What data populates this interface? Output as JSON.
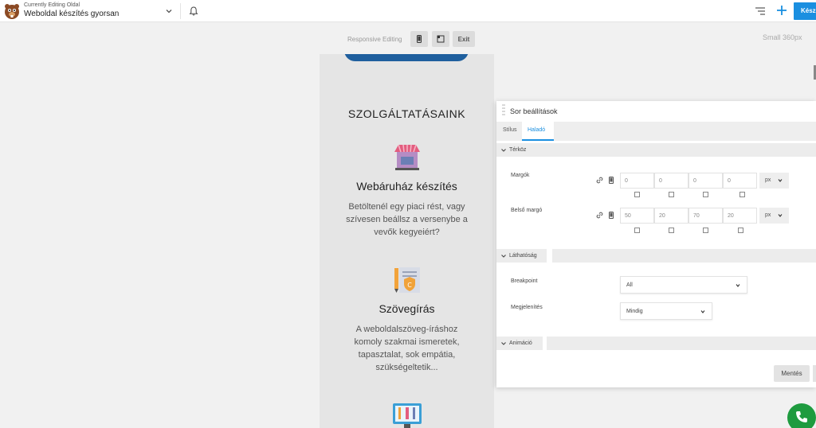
{
  "topbar": {
    "editing_label": "Currently Editing Oldal",
    "page_title": "Weboldal készítés gyorsan",
    "done_label": "Kész"
  },
  "responsive": {
    "label": "Responsive Editing",
    "exit_label": "Exit",
    "size_label": "Small 360px"
  },
  "preview": {
    "section_title": "SZOLGÁLTATÁSAINK",
    "services": [
      {
        "title": "Webáruház készítés",
        "lines": [
          "Betöltenél egy piaci rést, vagy",
          "szívesen beállsz a versenybe a",
          "vevők kegyeiért?"
        ],
        "icon": "shop-icon"
      },
      {
        "title": "Szövegírás",
        "lines": [
          "A weboldalszöveg-íráshoz",
          "komoly szakmai ismeretek,",
          "tapasztalat, sok empátia,",
          "szükségeltetik..."
        ],
        "icon": "copywriting-icon"
      },
      {
        "title": "",
        "lines": [],
        "icon": "design-tools-icon"
      }
    ]
  },
  "panel": {
    "title": "Sor beállítások",
    "tabs": [
      "Stílus",
      "Haladó"
    ],
    "active_tab": "Haladó",
    "spacing": {
      "label": "Térköz",
      "margins_label": "Margók",
      "margins": [
        "0",
        "0",
        "0",
        "0"
      ],
      "padding_label": "Belső margó",
      "padding": [
        "50",
        "20",
        "70",
        "20"
      ],
      "unit": "px"
    },
    "visibility": {
      "label": "Láthatóság",
      "breakpoint_label": "Breakpoint",
      "breakpoint_value": "All",
      "display_label": "Megjelenítés",
      "display_value": "Mindig"
    },
    "animation": {
      "label": "Animáció"
    },
    "save_label": "Mentés"
  },
  "colors": {
    "accent": "#1a8fe0",
    "call_button": "#1e9b3f",
    "preview_button": "#1f5f9e"
  }
}
